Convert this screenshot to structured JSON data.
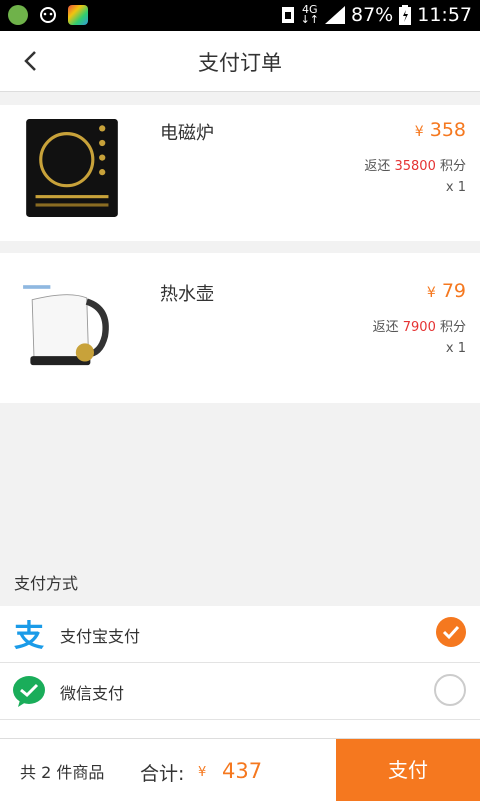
{
  "status_bar": {
    "network_top": "4G",
    "network_bottom": "↓↑",
    "battery": "87%",
    "time": "11:57"
  },
  "header": {
    "title": "支付订单"
  },
  "items": [
    {
      "name": "电磁炉",
      "price_prefix": "¥",
      "price": "358",
      "rebate_prefix": "返还",
      "rebate_value": "35800",
      "rebate_suffix": "积分",
      "qty": "x 1"
    },
    {
      "name": "热水壶",
      "price_prefix": "¥",
      "price": "79",
      "rebate_prefix": "返还",
      "rebate_value": "7900",
      "rebate_suffix": "积分",
      "qty": "x 1"
    }
  ],
  "payment": {
    "section_label": "支付方式",
    "methods": [
      {
        "label": "支付宝支付",
        "selected": true,
        "icon": "alipay-icon"
      },
      {
        "label": "微信支付",
        "selected": false,
        "icon": "wechat-icon"
      }
    ]
  },
  "footer": {
    "count_text": "共 2 件商品",
    "total_label": "合计:",
    "currency": "¥",
    "total": "437",
    "pay_button": "支付"
  },
  "colors": {
    "accent": "#f5781f",
    "rebate_red": "#e53333"
  }
}
